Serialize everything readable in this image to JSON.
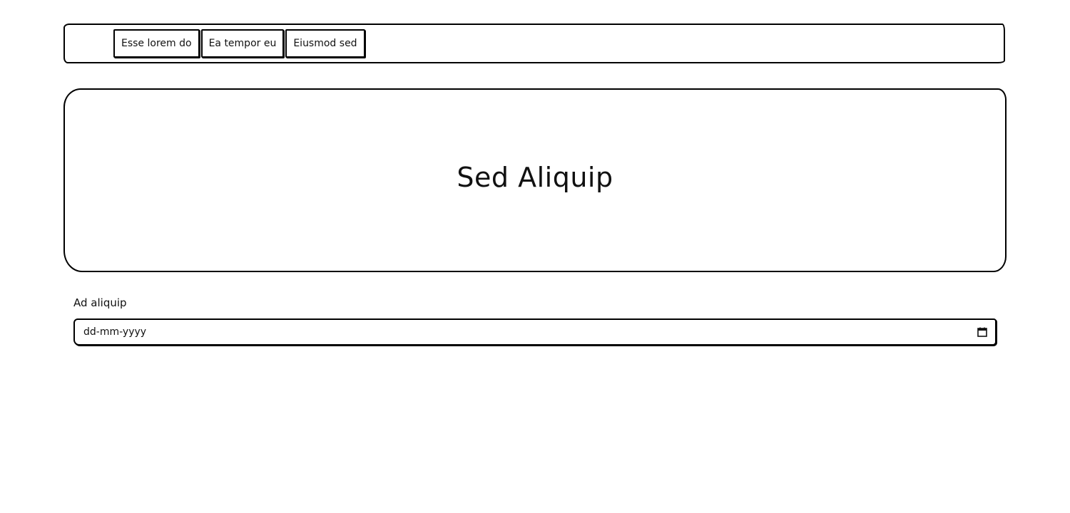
{
  "nav": {
    "buttons": [
      {
        "label": "Esse lorem do"
      },
      {
        "label": "Ea tempor eu"
      },
      {
        "label": "Eiusmod sed"
      }
    ]
  },
  "hero": {
    "title": "Sed Aliquip"
  },
  "form": {
    "date_label": "Ad aliquip",
    "date_placeholder": "dd-mm-yyyy",
    "calendar_icon": "calendar-icon"
  }
}
